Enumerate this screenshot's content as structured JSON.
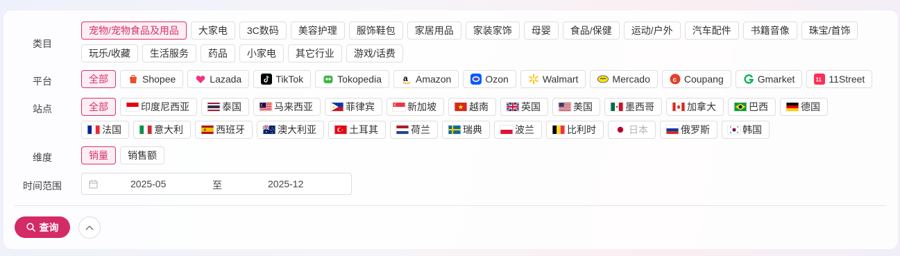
{
  "filters": {
    "category": {
      "label": "类目",
      "options": [
        "宠物/宠物食品及用品",
        "大家电",
        "3C数码",
        "美容护理",
        "服饰鞋包",
        "家居用品",
        "家装家饰",
        "母婴",
        "食品/保健",
        "运动/户外",
        "汽车配件",
        "书籍音像",
        "珠宝/首饰",
        "玩乐/收藏",
        "生活服务",
        "药品",
        "小家电",
        "其它行业",
        "游戏/话费"
      ],
      "selected": "宠物/宠物食品及用品"
    },
    "platform": {
      "label": "平台",
      "options": [
        {
          "name": "全部",
          "icon": ""
        },
        {
          "name": "Shopee",
          "icon": "shopee-icon",
          "color": "#ee4d2d"
        },
        {
          "name": "Lazada",
          "icon": "lazada-icon",
          "color": "#f5317f"
        },
        {
          "name": "TikTok",
          "icon": "tiktok-icon",
          "color": "#000000"
        },
        {
          "name": "Tokopedia",
          "icon": "tokopedia-icon",
          "color": "#42b549"
        },
        {
          "name": "Amazon",
          "icon": "amazon-icon",
          "color": "#000000"
        },
        {
          "name": "Ozon",
          "icon": "ozon-icon",
          "color": "#005bff"
        },
        {
          "name": "Walmart",
          "icon": "walmart-icon",
          "color": "#ffc220"
        },
        {
          "name": "Mercado",
          "icon": "mercado-icon",
          "color": "#ffe600"
        },
        {
          "name": "Coupang",
          "icon": "coupang-icon",
          "color": "#e43e2b"
        },
        {
          "name": "Gmarket",
          "icon": "gmarket-icon",
          "color": "#00b14f"
        },
        {
          "name": "11Street",
          "icon": "11street-icon",
          "color": "#ff2d55"
        }
      ],
      "selected": "全部"
    },
    "site": {
      "label": "站点",
      "options": [
        {
          "name": "全部",
          "flag": ""
        },
        {
          "name": "印度尼西亚",
          "flag": "flag-id-icon"
        },
        {
          "name": "泰国",
          "flag": "flag-th-icon"
        },
        {
          "name": "马来西亚",
          "flag": "flag-my-icon"
        },
        {
          "name": "菲律宾",
          "flag": "flag-ph-icon"
        },
        {
          "name": "新加坡",
          "flag": "flag-sg-icon"
        },
        {
          "name": "越南",
          "flag": "flag-vn-icon"
        },
        {
          "name": "英国",
          "flag": "flag-gb-icon"
        },
        {
          "name": "美国",
          "flag": "flag-us-icon"
        },
        {
          "name": "墨西哥",
          "flag": "flag-mx-icon"
        },
        {
          "name": "加拿大",
          "flag": "flag-ca-icon"
        },
        {
          "name": "巴西",
          "flag": "flag-br-icon"
        },
        {
          "name": "德国",
          "flag": "flag-de-icon"
        },
        {
          "name": "法国",
          "flag": "flag-fr-icon"
        },
        {
          "name": "意大利",
          "flag": "flag-it-icon"
        },
        {
          "name": "西班牙",
          "flag": "flag-es-icon"
        },
        {
          "name": "澳大利亚",
          "flag": "flag-au-icon"
        },
        {
          "name": "土耳其",
          "flag": "flag-tr-icon"
        },
        {
          "name": "荷兰",
          "flag": "flag-nl-icon"
        },
        {
          "name": "瑞典",
          "flag": "flag-se-icon"
        },
        {
          "name": "波兰",
          "flag": "flag-pl-icon"
        },
        {
          "name": "比利时",
          "flag": "flag-be-icon"
        },
        {
          "name": "日本",
          "flag": "flag-jp-icon",
          "disabled": true
        },
        {
          "name": "俄罗斯",
          "flag": "flag-ru-icon"
        },
        {
          "name": "韩国",
          "flag": "flag-kr-icon"
        }
      ],
      "selected": "全部"
    },
    "dimension": {
      "label": "维度",
      "options": [
        "销量",
        "销售额"
      ],
      "selected": "销量"
    },
    "time_range": {
      "label": "时间范围",
      "start": "2025-05",
      "separator": "至",
      "end": "2025-12",
      "icon": "calendar-icon"
    }
  },
  "actions": {
    "query_label": "查询",
    "query_icon": "search-icon",
    "collapse_icon": "chevron-up-icon"
  },
  "colors": {
    "accent": "#d42a65",
    "active_bg": "#fdeef3"
  }
}
